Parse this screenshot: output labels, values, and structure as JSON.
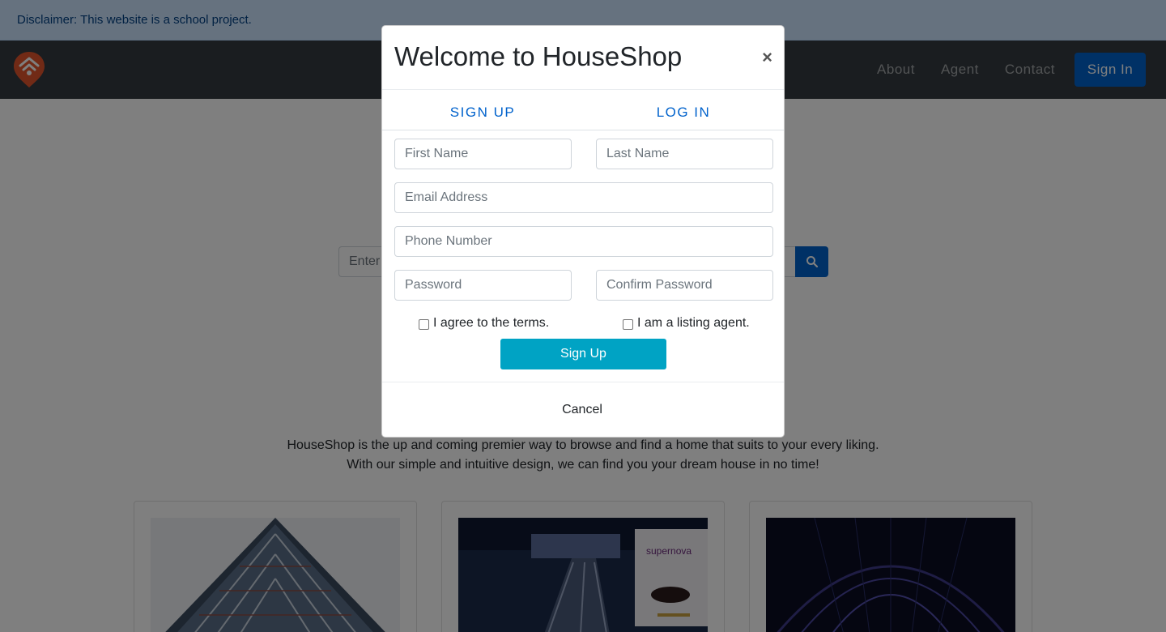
{
  "disclaimer": {
    "text": "Disclaimer: This website is a school project."
  },
  "navbar": {
    "logo_icon": "housepin-logo-icon",
    "links": [
      "About",
      "Agent",
      "Contact"
    ],
    "signin_label": "Sign In"
  },
  "search": {
    "placeholder_visible": "Enter",
    "button_icon": "search-icon"
  },
  "main": {
    "tagline_line1": "HouseShop is the up and coming premier way to browse and find a home that suits to your every liking.",
    "tagline_line2": "With our simple and intuitive design, we can find you your dream house in no time!",
    "cards": [
      {
        "image": "building-facade-photo"
      },
      {
        "image": "escalator-supernova-photo"
      },
      {
        "image": "arched-atrium-photo"
      }
    ],
    "card2_sign_text": "supernova"
  },
  "modal": {
    "title": "Welcome to HouseShop",
    "close_label": "×",
    "tabs": [
      "SIGN UP",
      "LOG IN"
    ],
    "fields": {
      "first_name": "First Name",
      "last_name": "Last Name",
      "email": "Email Address",
      "phone": "Phone Number",
      "password": "Password",
      "confirm_password": "Confirm Password"
    },
    "checks": {
      "terms": "I agree to the terms.",
      "agent": "I am a listing agent."
    },
    "submit_label": "Sign Up",
    "cancel_label": "Cancel"
  },
  "colors": {
    "brand_blue": "#0062cc",
    "signup_teal": "#00a3c4",
    "navbar_dark": "#343a40",
    "logo_orange": "#e2552c",
    "disclaimer_bg": "#cce5ff"
  }
}
